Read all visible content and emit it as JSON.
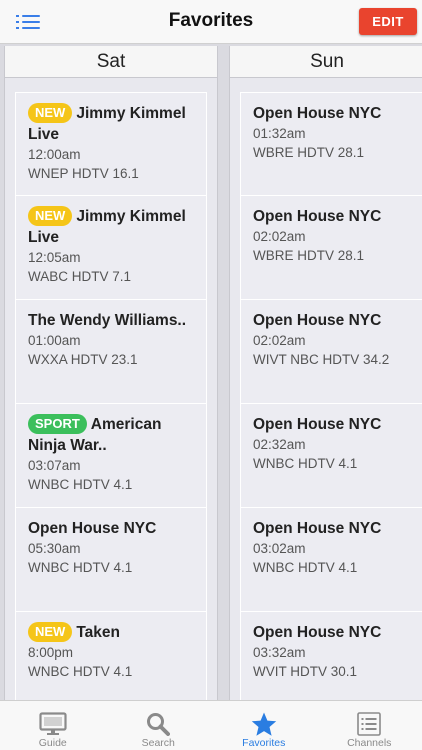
{
  "header": {
    "title": "Favorites",
    "edit_label": "EDIT"
  },
  "days": [
    {
      "label": "Sat",
      "cards": [
        {
          "badge": "NEW",
          "badge_type": "new",
          "title": "Jimmy Kimmel Live",
          "time": "12:00am",
          "channel": "WNEP HDTV 16.1"
        },
        {
          "badge": "NEW",
          "badge_type": "new",
          "title": "Jimmy Kimmel Live",
          "time": "12:05am",
          "channel": "WABC HDTV 7.1"
        },
        {
          "badge": "",
          "badge_type": "",
          "title": "The Wendy Williams..",
          "time": "01:00am",
          "channel": "WXXA HDTV 23.1"
        },
        {
          "badge": "SPORT",
          "badge_type": "sport",
          "title": "American Ninja War..",
          "time": "03:07am",
          "channel": "WNBC HDTV 4.1"
        },
        {
          "badge": "",
          "badge_type": "",
          "title": "Open House NYC",
          "time": "05:30am",
          "channel": "WNBC HDTV 4.1"
        },
        {
          "badge": "NEW",
          "badge_type": "new",
          "title": "Taken",
          "time": "8:00pm",
          "channel": "WNBC HDTV 4.1"
        }
      ]
    },
    {
      "label": "Sun",
      "cards": [
        {
          "badge": "",
          "badge_type": "",
          "title": "Open House NYC",
          "time": "01:32am",
          "channel": "WBRE HDTV 28.1"
        },
        {
          "badge": "",
          "badge_type": "",
          "title": "Open House NYC",
          "time": "02:02am",
          "channel": "WBRE HDTV 28.1"
        },
        {
          "badge": "",
          "badge_type": "",
          "title": "Open House NYC",
          "time": "02:02am",
          "channel": "WIVT NBC HDTV 34.2"
        },
        {
          "badge": "",
          "badge_type": "",
          "title": "Open House NYC",
          "time": "02:32am",
          "channel": "WNBC HDTV 4.1"
        },
        {
          "badge": "",
          "badge_type": "",
          "title": "Open House NYC",
          "time": "03:02am",
          "channel": "WNBC HDTV 4.1"
        },
        {
          "badge": "",
          "badge_type": "",
          "title": "Open House NYC",
          "time": "03:32am",
          "channel": "WVIT HDTV 30.1"
        }
      ]
    }
  ],
  "tabs": [
    {
      "label": "Guide",
      "icon": "tv-icon",
      "active": false
    },
    {
      "label": "Search",
      "icon": "search-icon",
      "active": false
    },
    {
      "label": "Favorites",
      "icon": "star-icon",
      "active": true
    },
    {
      "label": "Channels",
      "icon": "list-icon",
      "active": false
    }
  ],
  "colors": {
    "accent": "#2a7de1",
    "edit_button": "#e9442e",
    "badge_new": "#f5c518",
    "badge_sport": "#3bbf5c"
  }
}
